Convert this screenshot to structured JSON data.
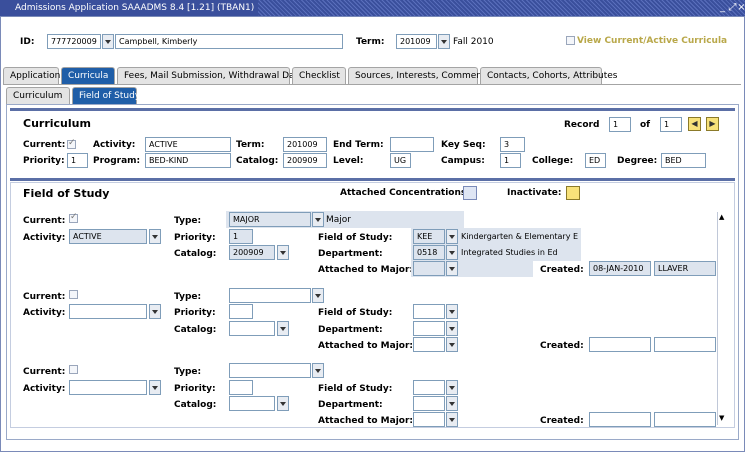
{
  "window": {
    "title": "Admissions Application  SAAADMS  8.4  [1.21]  (TBAN1)",
    "restore_glyph": "⤢",
    "close_glyph": "×"
  },
  "key_block": {
    "id_label": "ID:",
    "id_value": "777720009",
    "name": "Campbell, Kimberly",
    "term_label": "Term:",
    "term_value": "201009",
    "term_desc": "Fall 2010",
    "view_curricula_label": "View Current/Active Curricula"
  },
  "tabs": [
    {
      "label": "Application",
      "active": false
    },
    {
      "label": "Curricula",
      "active": true
    },
    {
      "label": "Fees, Mail Submission, Withdrawal Data",
      "active": false
    },
    {
      "label": "Checklist",
      "active": false
    },
    {
      "label": "Sources, Interests, Comments",
      "active": false
    },
    {
      "label": "Contacts, Cohorts, Attributes",
      "active": false
    }
  ],
  "subtabs": [
    {
      "label": "Curriculum",
      "active": false
    },
    {
      "label": "Field of Study",
      "active": true
    }
  ],
  "curriculum": {
    "heading": "Curriculum",
    "record_label": "Record",
    "record_value": "1",
    "of_label": "of",
    "of_value": "1",
    "current_label": "Current:",
    "activity_label": "Activity:",
    "activity_value": "ACTIVE",
    "term_label": "Term:",
    "term_value": "201009",
    "end_term_label": "End Term:",
    "end_term_value": "",
    "key_seq_label": "Key Seq:",
    "key_seq_value": "3",
    "priority_label": "Priority:",
    "priority_value": "1",
    "program_label": "Program:",
    "program_value": "BED-KIND",
    "catalog_label": "Catalog:",
    "catalog_value": "200909",
    "level_label": "Level:",
    "level_value": "UG",
    "campus_label": "Campus:",
    "campus_value": "1",
    "college_label": "College:",
    "college_value": "ED",
    "degree_label": "Degree:",
    "degree_value": "BED"
  },
  "field_of_study": {
    "heading": "Field of Study",
    "attached_conc_label": "Attached Concentrations:",
    "inactivate_label": "Inactivate:",
    "labels": {
      "current": "Current:",
      "activity": "Activity:",
      "type": "Type:",
      "priority": "Priority:",
      "catalog": "Catalog:",
      "field_of_study": "Field of Study:",
      "department": "Department:",
      "attached_to_major": "Attached to Major:",
      "created": "Created:"
    },
    "records": [
      {
        "current": true,
        "activity": "ACTIVE",
        "type": "MAJOR",
        "type_desc": "Major",
        "priority": "1",
        "catalog": "200909",
        "field_of_study": "KEE",
        "field_of_study_desc": "Kindergarten & Elementary E",
        "department": "0518",
        "department_desc": "Integrated Studies in Ed",
        "attached_to_major": "",
        "created_date": "08-JAN-2010",
        "created_user": "LLAVER"
      },
      {
        "current": false,
        "activity": "",
        "type": "",
        "type_desc": "",
        "priority": "",
        "catalog": "",
        "field_of_study": "",
        "field_of_study_desc": "",
        "department": "",
        "department_desc": "",
        "attached_to_major": "",
        "created_date": "",
        "created_user": ""
      },
      {
        "current": false,
        "activity": "",
        "type": "",
        "type_desc": "",
        "priority": "",
        "catalog": "",
        "field_of_study": "",
        "field_of_study_desc": "",
        "department": "",
        "department_desc": "",
        "attached_to_major": "",
        "created_date": "",
        "created_user": ""
      }
    ]
  },
  "colors": {
    "titlebar": "#3a4f9c",
    "active_tab": "#1f5ea8",
    "readonly_field": "#dde4ee",
    "nav_button": "#f8e27a"
  },
  "icons": {
    "prev_record": "◀",
    "next_record": "▶"
  }
}
